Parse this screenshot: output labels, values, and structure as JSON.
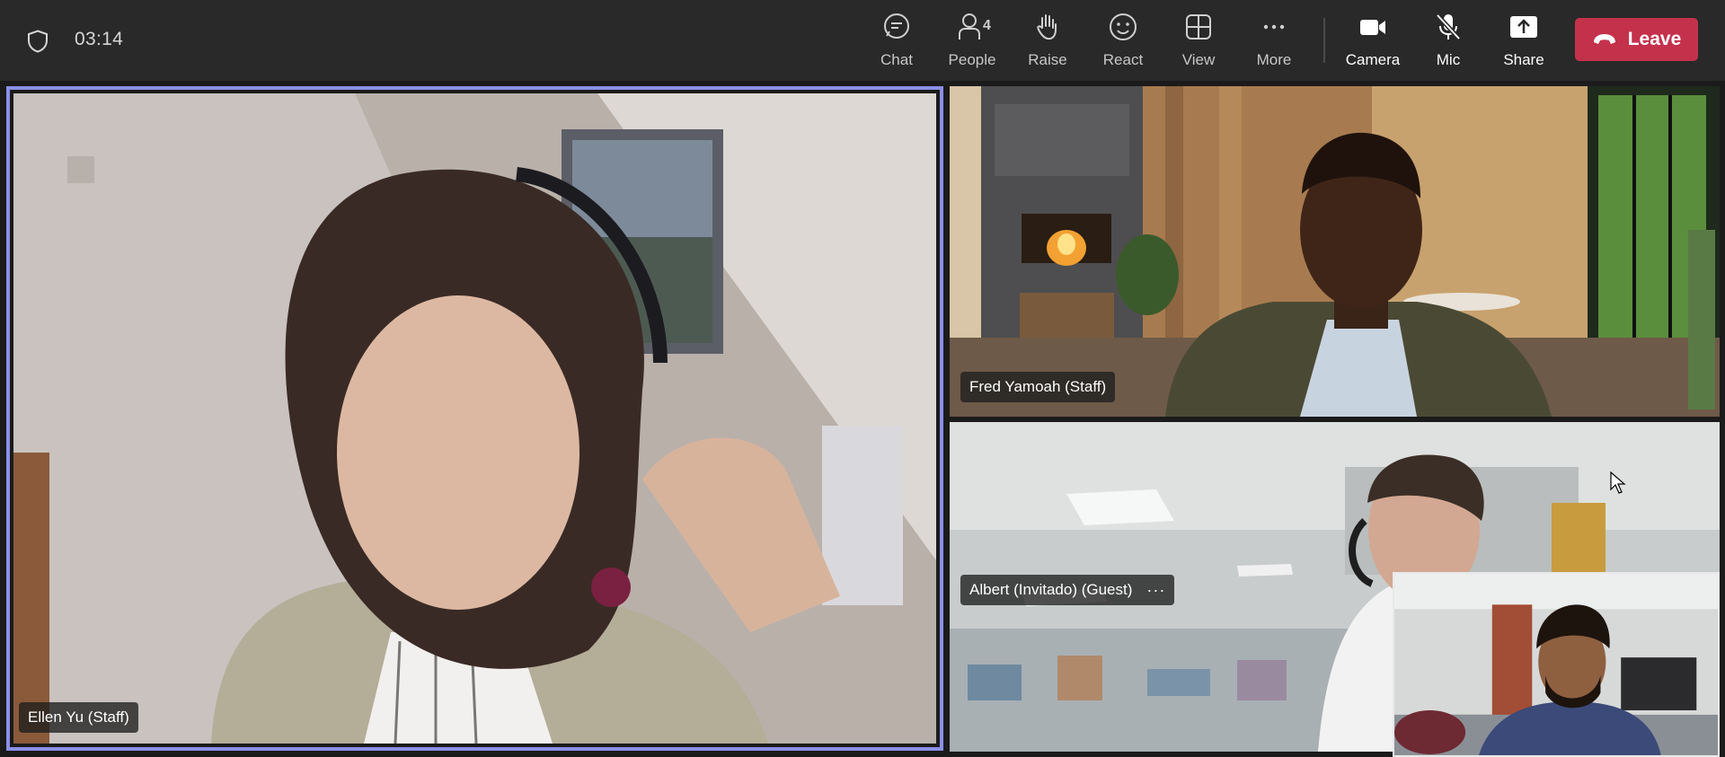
{
  "call": {
    "timer": "03:14"
  },
  "toolbar": {
    "chat": "Chat",
    "people": "People",
    "people_count": "4",
    "raise": "Raise",
    "react": "React",
    "view": "View",
    "more": "More",
    "camera": "Camera",
    "mic": "Mic",
    "share": "Share",
    "leave": "Leave"
  },
  "participants": {
    "main": "Ellen Yu (Staff)",
    "top_right": "Fred Yamoah (Staff)",
    "bottom_right": "Albert (Invitado) (Guest)"
  },
  "colors": {
    "accent": "#8b8fe8",
    "leave": "#c4314b",
    "topbar": "#292929"
  }
}
